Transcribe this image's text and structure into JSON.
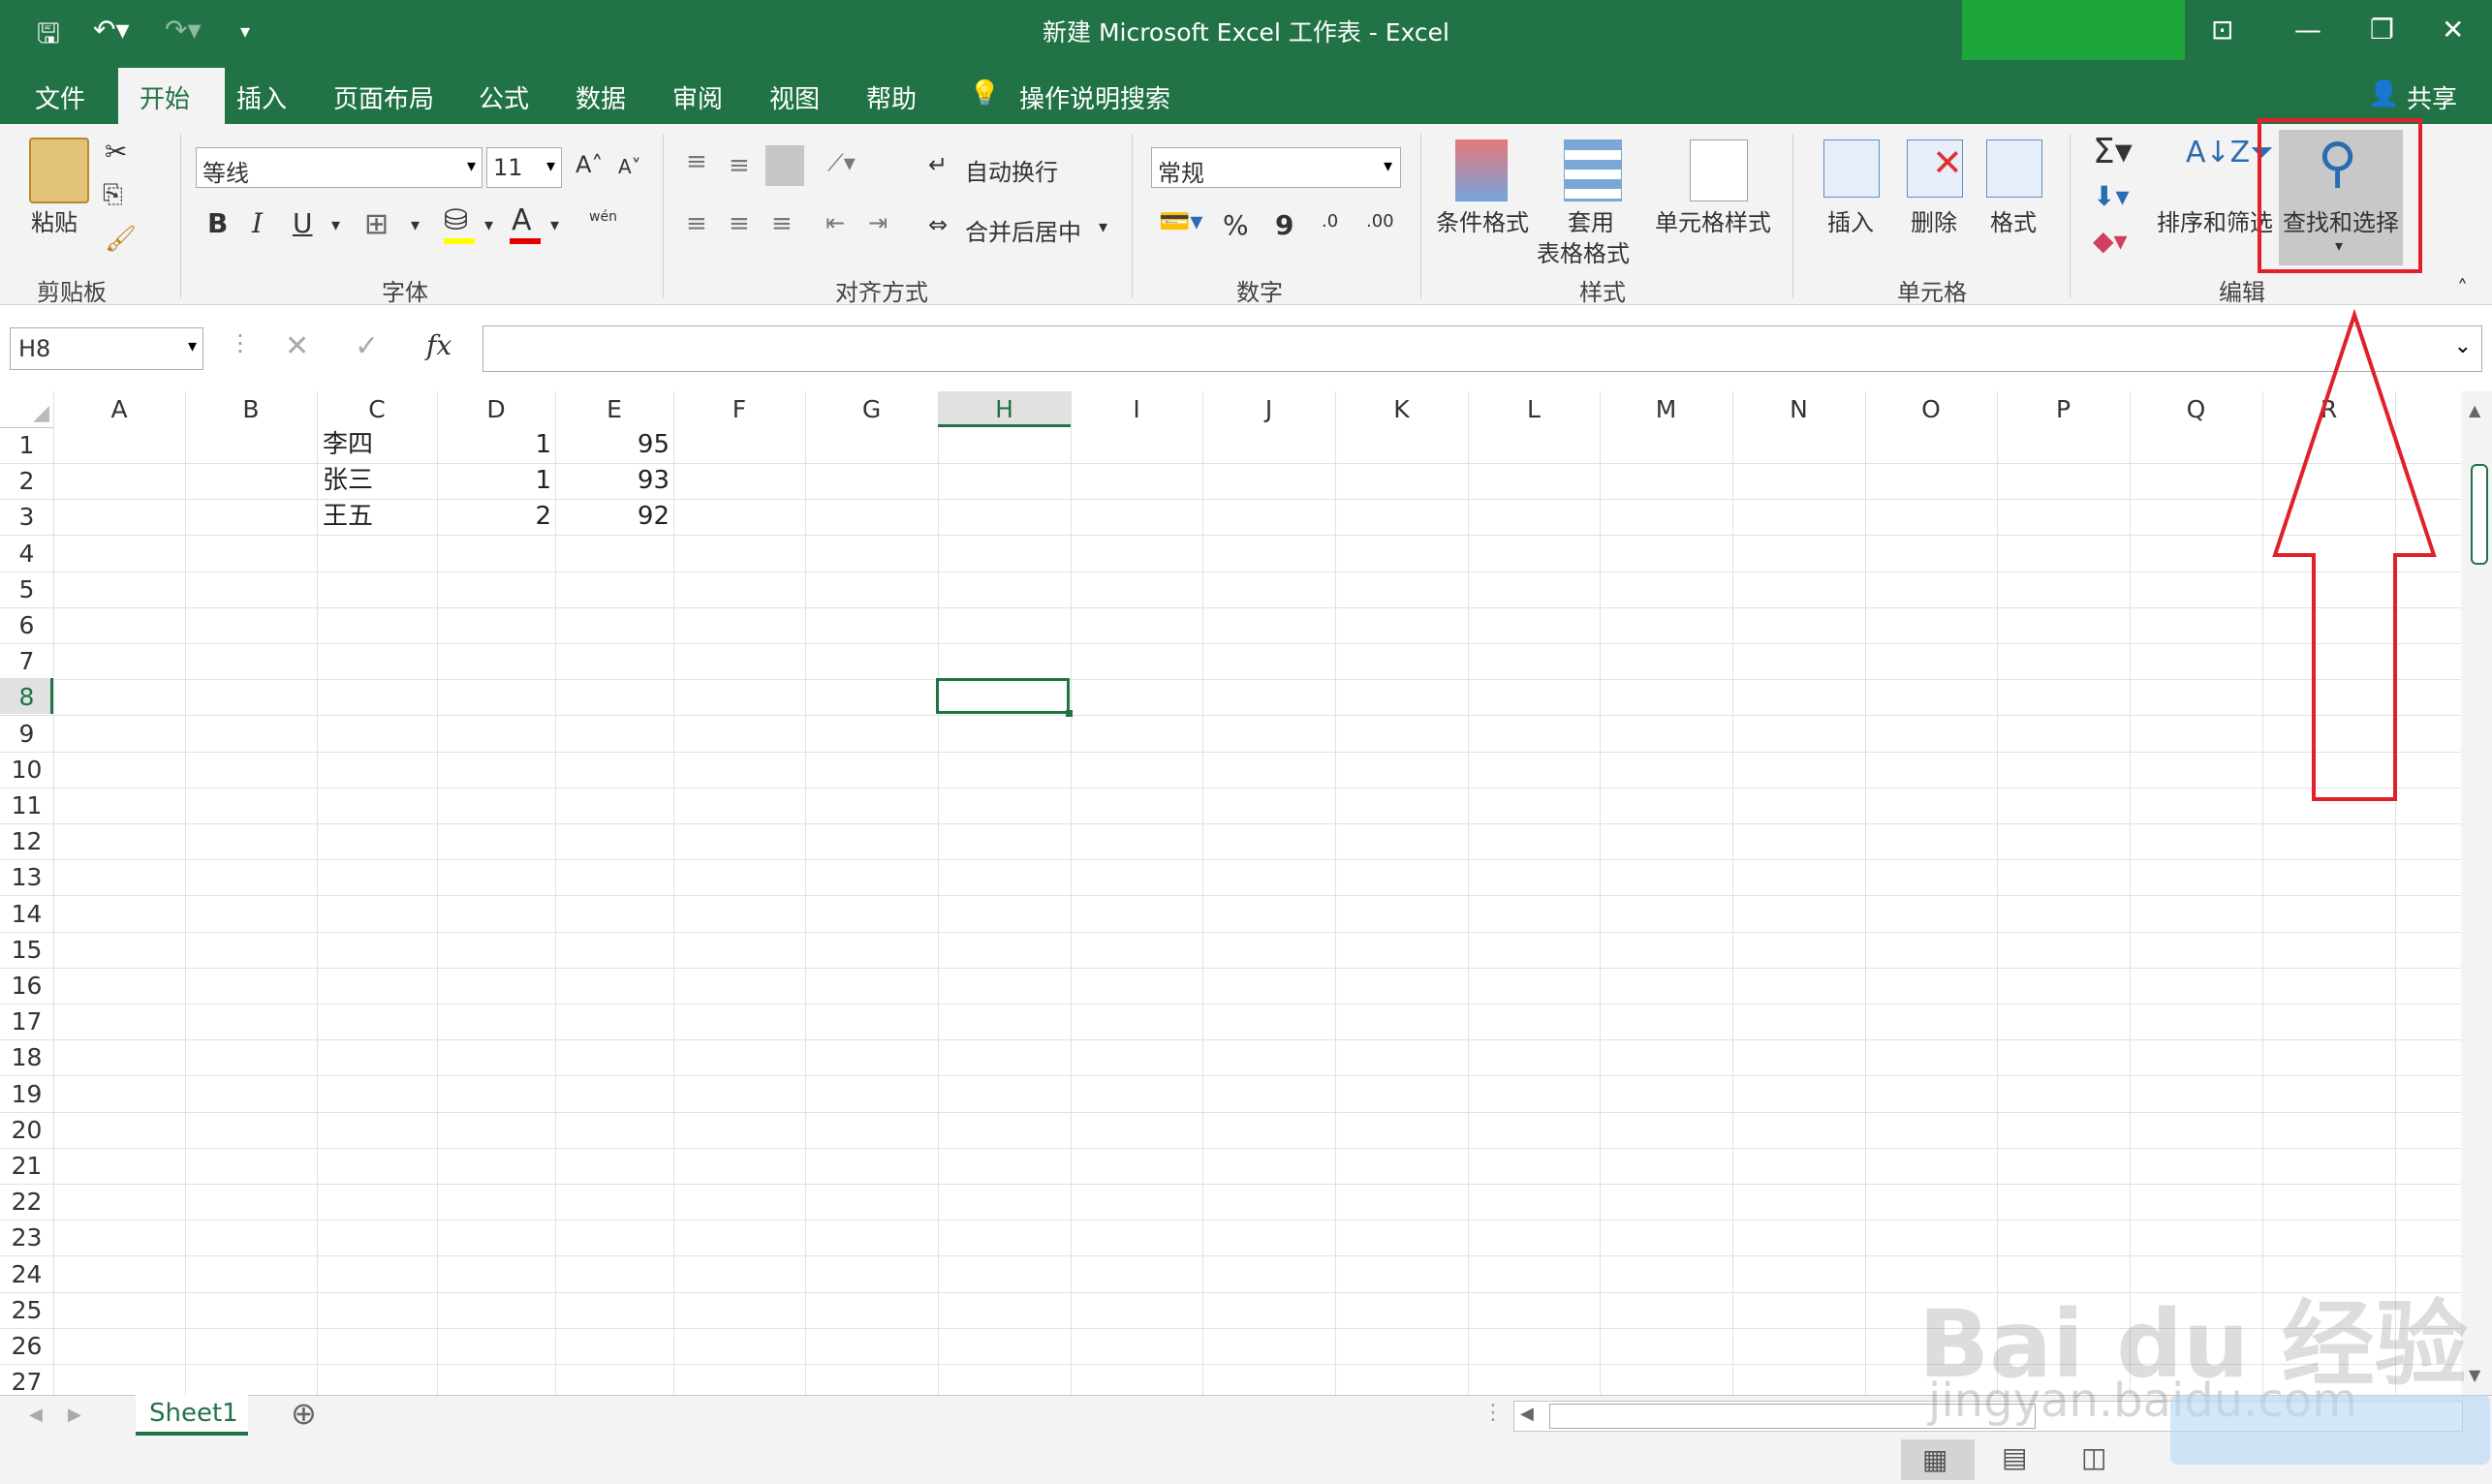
{
  "window": {
    "title": "新建 Microsoft Excel 工作表  -  Excel",
    "share_label": "共享"
  },
  "tabs": [
    "文件",
    "开始",
    "插入",
    "页面布局",
    "公式",
    "数据",
    "审阅",
    "视图",
    "帮助"
  ],
  "tell_me": "操作说明搜索",
  "ribbon": {
    "clipboard": {
      "paste": "粘贴",
      "group": "剪贴板"
    },
    "font": {
      "name": "等线",
      "size": "11",
      "bold": "B",
      "italic": "I",
      "underline": "U",
      "wen": "wén",
      "group": "字体"
    },
    "alignment": {
      "wrap": "自动换行",
      "merge": "合并后居中",
      "group": "对齐方式"
    },
    "number": {
      "format": "常规",
      "percent": "%",
      "comma": "9",
      "inc": ".00",
      "dec": ".0",
      "group": "数字"
    },
    "styles": {
      "conditional": "条件格式",
      "table_l1": "套用",
      "table_l2": "表格格式",
      "cell": "单元格样式",
      "group": "样式"
    },
    "cells": {
      "insert": "插入",
      "delete": "删除",
      "format": "格式",
      "group": "单元格"
    },
    "editing": {
      "sort": "排序和筛选",
      "find": "查找和选择",
      "group": "编辑"
    }
  },
  "formula_bar": {
    "name_box": "H8",
    "fx": "fx",
    "value": ""
  },
  "grid": {
    "columns": [
      "A",
      "B",
      "C",
      "D",
      "E",
      "F",
      "G",
      "H",
      "I",
      "J",
      "K",
      "L",
      "M",
      "N",
      "O",
      "P",
      "Q",
      "R"
    ],
    "rows": [
      "1",
      "2",
      "3",
      "4",
      "5",
      "6",
      "7",
      "8",
      "9",
      "10",
      "11",
      "12",
      "13",
      "14",
      "15",
      "16",
      "17",
      "18",
      "19",
      "20",
      "21",
      "22",
      "23",
      "24",
      "25",
      "26",
      "27"
    ],
    "active_cell": "H8",
    "data": [
      [
        "李四",
        "1",
        "95"
      ],
      [
        "张三",
        "1",
        "93"
      ],
      [
        "王五",
        "2",
        "92"
      ]
    ]
  },
  "sheets": [
    "Sheet1"
  ],
  "watermark": {
    "brand": "Bai du 经验",
    "url": "jingyan.baidu.com"
  },
  "colors": {
    "excel_green": "#217346",
    "annotation_red": "#e0202a"
  }
}
